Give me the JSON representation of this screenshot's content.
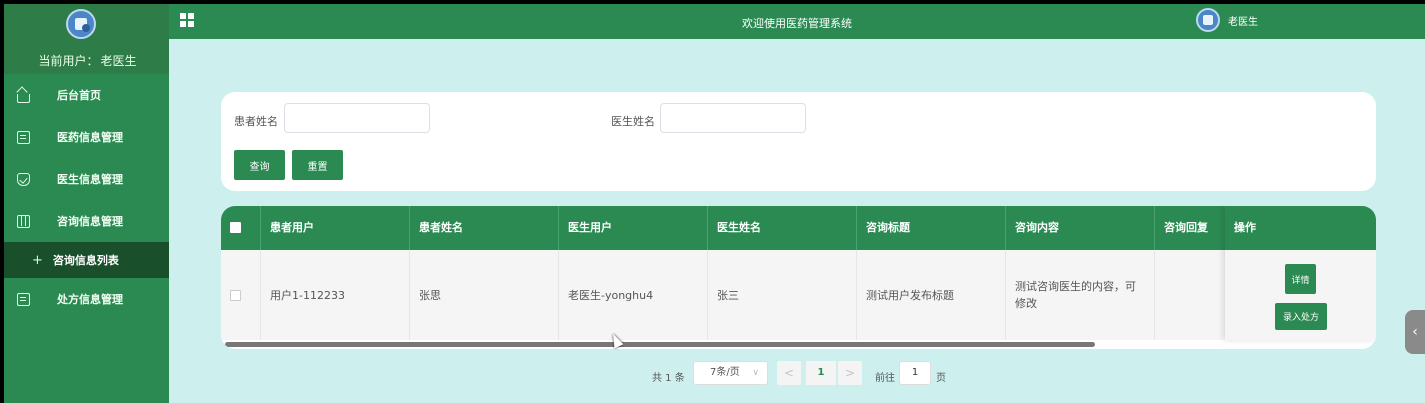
{
  "sidebar": {
    "current_user_label": "当前用户：",
    "current_user_name": "老医生",
    "items": [
      {
        "label": "后台首页",
        "icon": "home-icon"
      },
      {
        "label": "医药信息管理",
        "icon": "document-icon"
      },
      {
        "label": "医生信息管理",
        "icon": "shield-check-icon"
      },
      {
        "label": "咨询信息管理",
        "icon": "columns-icon"
      },
      {
        "label": "咨询信息列表",
        "icon": "plus-icon",
        "active": true
      },
      {
        "label": "处方信息管理",
        "icon": "document-icon"
      }
    ]
  },
  "topbar": {
    "title": "欢迎使用医药管理系统",
    "user": "老医生"
  },
  "search": {
    "patient_label": "患者姓名",
    "patient_value": "",
    "doctor_label": "医生姓名",
    "doctor_value": "",
    "query_button": "查询",
    "reset_button": "重置"
  },
  "table": {
    "headers": [
      "患者用户",
      "患者姓名",
      "医生用户",
      "医生姓名",
      "咨询标题",
      "咨询内容",
      "咨询回复"
    ],
    "actions_header": "操作",
    "rows": [
      {
        "patient_user": "用户1-112233",
        "patient_name": "张思",
        "doctor_user": "老医生-yonghu4",
        "doctor_name": "张三",
        "title": "测试用户发布标题",
        "content": "测试咨询医生的内容，可修改",
        "reply": "",
        "detail_button": "详情",
        "prescription_button": "录入处方"
      }
    ]
  },
  "pagination": {
    "total": "共 1 条",
    "page_size": "7条/页",
    "prev": "<",
    "current_page": "1",
    "next": ">",
    "goto_label": "前往",
    "goto_value": "1",
    "page_suffix": "页"
  },
  "colors": {
    "primary": "#2b8a52",
    "sidebar_active": "#1a4f2b",
    "background": "#cdf0ef"
  }
}
